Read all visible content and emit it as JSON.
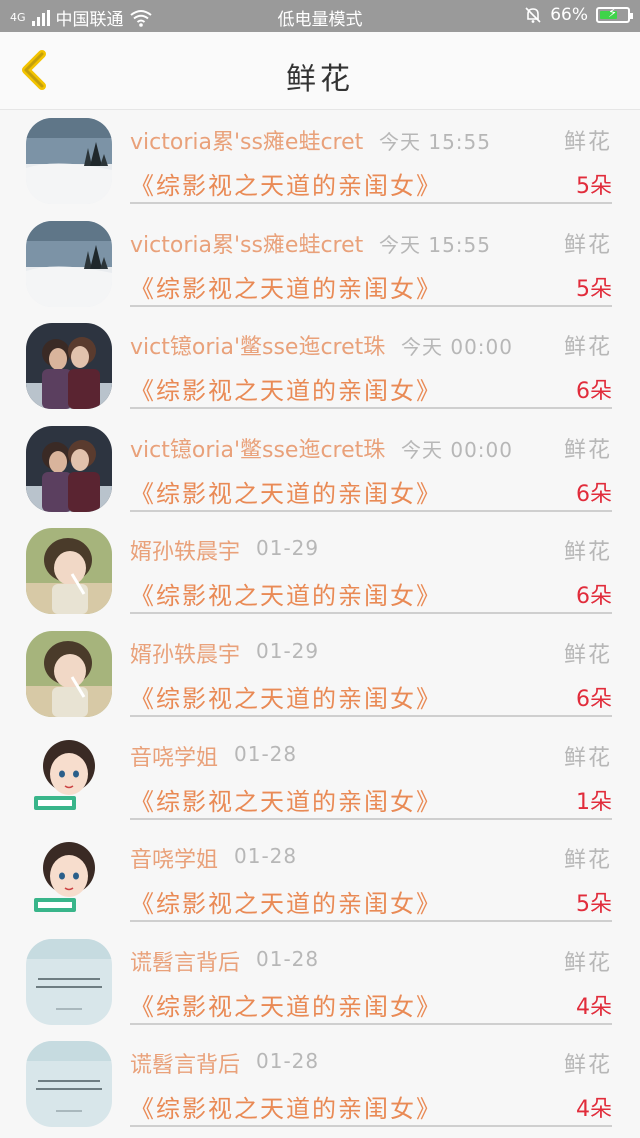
{
  "status_bar": {
    "network": "4G",
    "carrier": "中国联通",
    "mode": "低电量模式",
    "battery": "66%",
    "battery_level": 0.66,
    "colors": {
      "bar": "#9a9a9a",
      "battery_fill": "#3fd34a"
    }
  },
  "header": {
    "title": "鲜花"
  },
  "icons": {
    "back": "chevron-left-icon",
    "wifi": "wifi-icon",
    "signal": "signal-icon",
    "mute": "bell-off-icon",
    "battery": "battery-charging-icon"
  },
  "colors": {
    "name": "#e9a17a",
    "book": "#e98a55",
    "count": "#e12c3b",
    "muted": "#b7b7b7"
  },
  "items": [
    {
      "name": "victoria累'ss瘫e蛙cret",
      "time": "今天 15:55",
      "gift": "鲜花",
      "book": "《综影视之天道的亲闺女》",
      "count": "5朵",
      "avatar": "snow-landscape"
    },
    {
      "name": "victoria累'ss瘫e蛙cret",
      "time": "今天 15:55",
      "gift": "鲜花",
      "book": "《综影视之天道的亲闺女》",
      "count": "5朵",
      "avatar": "snow-landscape"
    },
    {
      "name": "vict镱oria'鳖sse迤cret珠",
      "time": "今天 00:00",
      "gift": "鲜花",
      "book": "《综影视之天道的亲闺女》",
      "count": "6朵",
      "avatar": "couple"
    },
    {
      "name": "vict镱oria'鳖sse迤cret珠",
      "time": "今天 00:00",
      "gift": "鲜花",
      "book": "《综影视之天道的亲闺女》",
      "count": "6朵",
      "avatar": "couple"
    },
    {
      "name": "婿孙轶晨宇",
      "time": "01-29",
      "gift": "鲜花",
      "book": "《综影视之天道的亲闺女》",
      "count": "6朵",
      "avatar": "drink-person"
    },
    {
      "name": "婿孙轶晨宇",
      "time": "01-29",
      "gift": "鲜花",
      "book": "《综影视之天道的亲闺女》",
      "count": "6朵",
      "avatar": "drink-person"
    },
    {
      "name": "音哓学姐",
      "time": "01-28",
      "gift": "鲜花",
      "book": "《综影视之天道的亲闺女》",
      "count": "1朵",
      "avatar": "cartoon-girl"
    },
    {
      "name": "音哓学姐",
      "time": "01-28",
      "gift": "鲜花",
      "book": "《综影视之天道的亲闺女》",
      "count": "5朵",
      "avatar": "cartoon-girl"
    },
    {
      "name": "谎髫言背后",
      "time": "01-28",
      "gift": "鲜花",
      "book": "《综影视之天道的亲闺女》",
      "count": "4朵",
      "avatar": "text-card"
    },
    {
      "name": "谎髫言背后",
      "time": "01-28",
      "gift": "鲜花",
      "book": "《综影视之天道的亲闺女》",
      "count": "4朵",
      "avatar": "text-card"
    }
  ]
}
